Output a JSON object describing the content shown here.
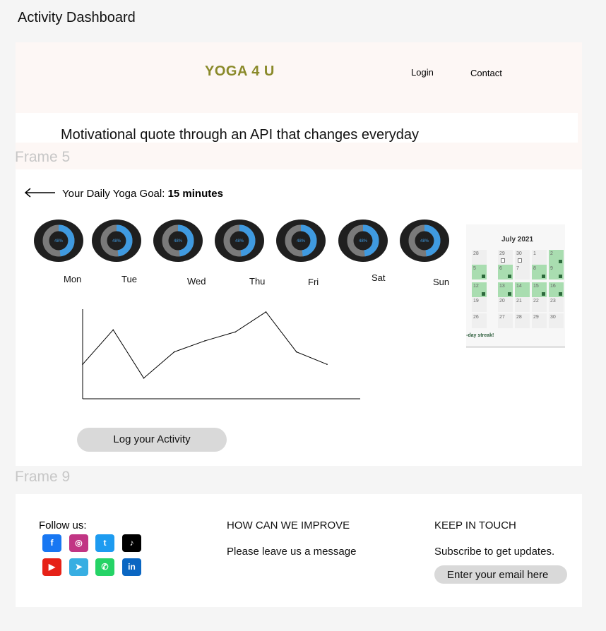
{
  "page_title": "Activity Dashboard",
  "header": {
    "logo": "YOGA 4 U",
    "nav": {
      "login": "Login",
      "contact": "Contact"
    },
    "quote": "Motivational quote through an API that changes everyday"
  },
  "frame_labels": {
    "top": "Frame 5",
    "bottom": "Frame 9"
  },
  "goal": {
    "label": "Your Daily Yoga Goal: ",
    "value": "15 minutes"
  },
  "days": [
    {
      "name": "Mon",
      "progress_label": "48%",
      "progress": 0.48
    },
    {
      "name": "Tue",
      "progress_label": "48%",
      "progress": 0.48
    },
    {
      "name": "Wed",
      "progress_label": "48%",
      "progress": 0.48
    },
    {
      "name": "Thu",
      "progress_label": "48%",
      "progress": 0.48
    },
    {
      "name": "Fri",
      "progress_label": "48%",
      "progress": 0.48
    },
    {
      "name": "Sat",
      "progress_label": "48%",
      "progress": 0.48
    },
    {
      "name": "Sun",
      "progress_label": "48%",
      "progress": 0.48
    }
  ],
  "calendar": {
    "title": "July 2021",
    "rows": [
      [
        "28",
        "29",
        "30",
        "1",
        "2",
        "3"
      ],
      [
        "5",
        "6",
        "7",
        "8",
        "9",
        "10"
      ],
      [
        "12",
        "13",
        "14",
        "15",
        "16",
        "17"
      ],
      [
        "19",
        "20",
        "21",
        "22",
        "23",
        "24"
      ],
      [
        "26",
        "27",
        "28",
        "29",
        "30",
        "31"
      ]
    ],
    "streak_text": "-day streak!"
  },
  "chart_data": {
    "type": "line",
    "values": [
      50,
      100,
      30,
      68,
      84,
      97,
      126,
      68,
      50
    ],
    "ylim": [
      0,
      130
    ],
    "grid": false,
    "title": "",
    "xlabel": "",
    "ylabel": ""
  },
  "log_button": "Log your Activity",
  "footer": {
    "follow": "Follow us:",
    "improve_heading": "HOW CAN WE IMPROVE",
    "improve_text": "Please leave us a message",
    "touch_heading": "KEEP IN TOUCH",
    "touch_text": "Subscribe to get updates.",
    "email_placeholder": "Enter your email here",
    "socials": [
      {
        "icon": "facebook-icon",
        "glyph": "f",
        "color": "#1877f2"
      },
      {
        "icon": "instagram-icon",
        "glyph": "◎",
        "color": "#c13584"
      },
      {
        "icon": "twitter-icon",
        "glyph": "t",
        "color": "#1d9bf0"
      },
      {
        "icon": "tiktok-icon",
        "glyph": "♪",
        "color": "#000000"
      },
      {
        "icon": "youtube-icon",
        "glyph": "▶",
        "color": "#e62117"
      },
      {
        "icon": "telegram-icon",
        "glyph": "➤",
        "color": "#37aee2"
      },
      {
        "icon": "whatsapp-icon",
        "glyph": "✆",
        "color": "#25d366"
      },
      {
        "icon": "linkedin-icon",
        "glyph": "in",
        "color": "#0a66c2"
      }
    ]
  },
  "colors": {
    "ring_progress": "#3f9ae0",
    "ring_track": "#7a7a7a",
    "ring_bg": "#1f1f1f",
    "logo": "#8a8a2a",
    "calendar_green": "#a9ddb0"
  }
}
